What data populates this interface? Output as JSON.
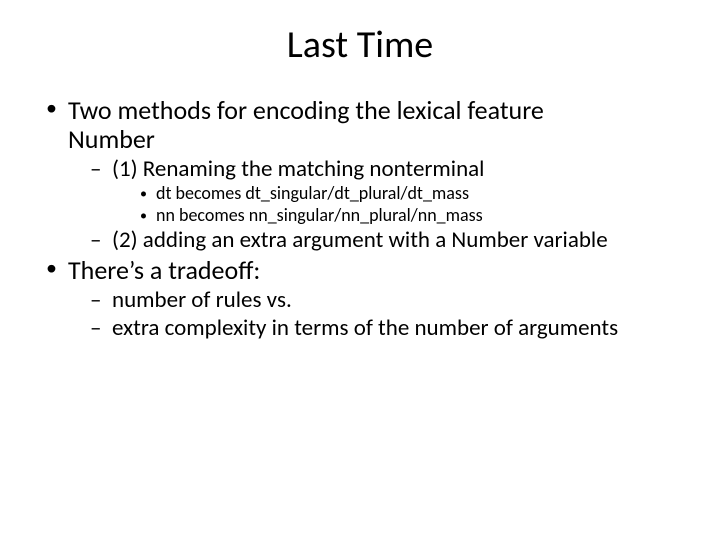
{
  "title": "Last Time",
  "b1": {
    "text_a": "Two methods for encoding the lexical feature",
    "text_b": "Number",
    "s1": {
      "text": "(1) Renaming the matching nonterminal",
      "e1": "dt becomes dt_singular/dt_plural/dt_mass",
      "e2": "nn becomes nn_singular/nn_plural/nn_mass"
    },
    "s2": {
      "text": "(2) adding an extra argument with a Number variable"
    }
  },
  "b2": {
    "text": "There’s a tradeoff:",
    "s1": {
      "text": "number of rules vs."
    },
    "s2": {
      "text": "extra complexity in terms of the number of arguments"
    }
  }
}
